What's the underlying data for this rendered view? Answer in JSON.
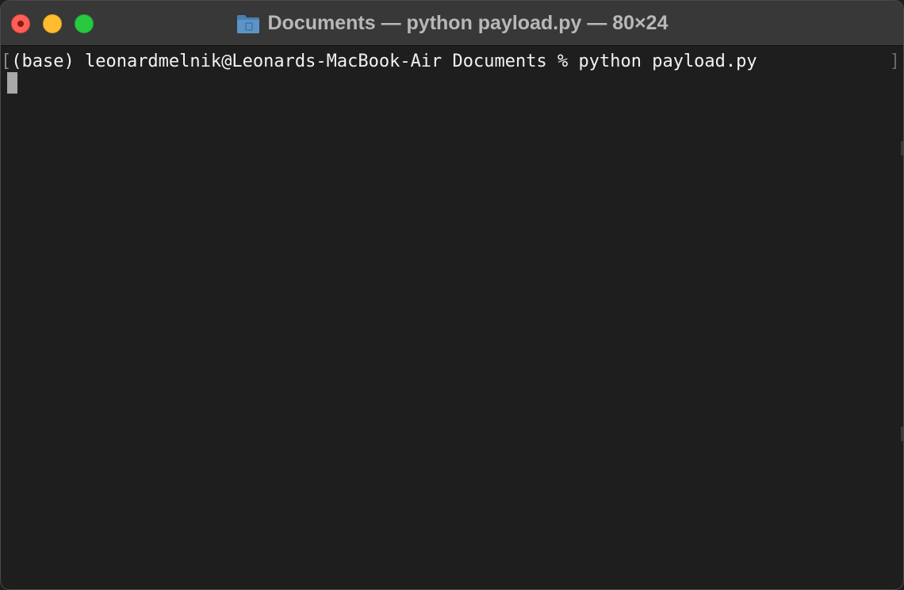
{
  "window": {
    "title": "Documents — python payload.py — 80×24",
    "folder_icon": "folder-icon"
  },
  "terminal": {
    "left_bracket": "[",
    "prompt_line": "(base) leonardmelnik@Leonards-MacBook-Air Documents % python payload.py",
    "right_bracket": "]"
  },
  "colors": {
    "background": "#1e1e1e",
    "titlebar": "#383838",
    "text": "#f2f2f2",
    "cursor": "#a8a8a8",
    "close": "#ff5f57",
    "minimize": "#febc2e",
    "zoom": "#28c840"
  }
}
